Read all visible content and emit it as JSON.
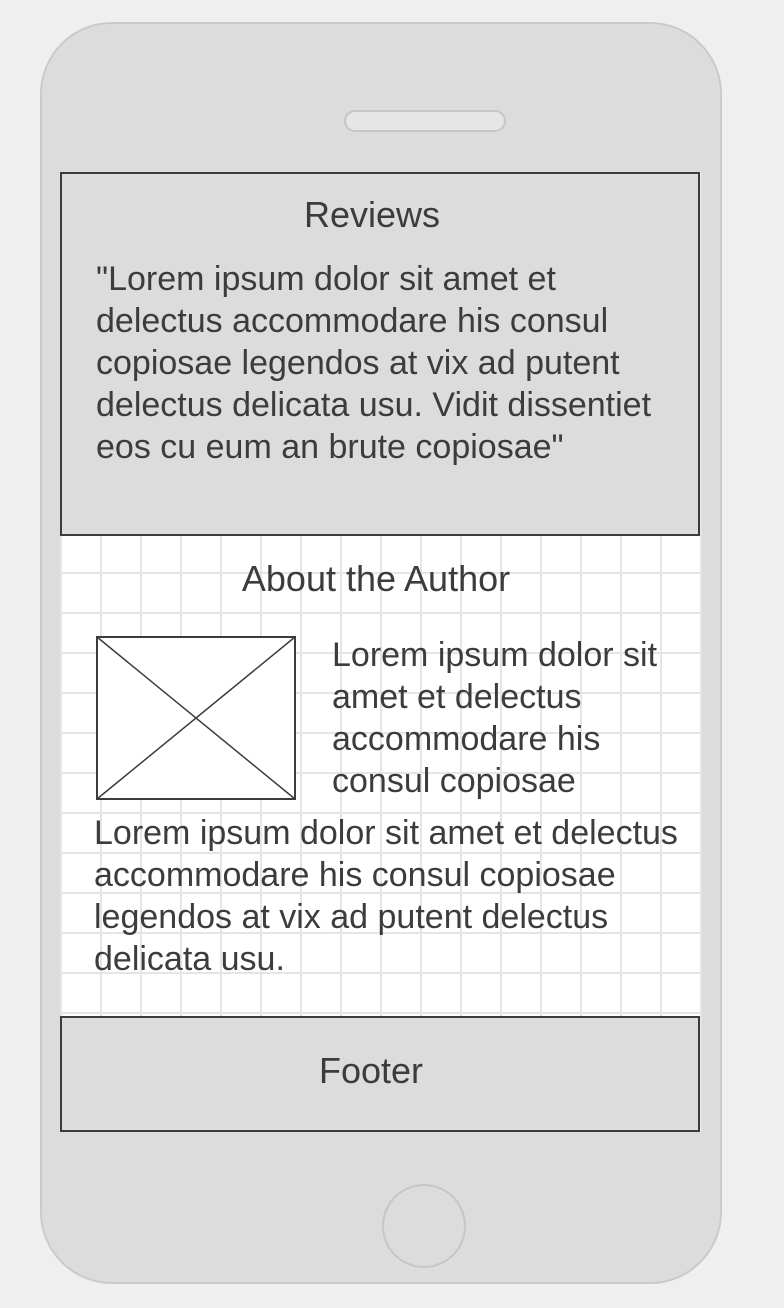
{
  "reviews": {
    "title": "Reviews",
    "quote": "\"Lorem ipsum dolor sit amet et delectus accommodare his consul copiosae legendos at vix ad putent delectus delicata usu. Vidit dissentiet eos cu eum an brute copiosae\""
  },
  "about": {
    "title": "About the Author",
    "photo_icon": "image-placeholder-icon",
    "short_text": "Lorem ipsum dolor sit amet et delectus accommodare his consul copiosae",
    "bio": "Lorem ipsum dolor sit amet et delectus accommodare his consul copiosae legendos at vix ad putent delectus delicata usu."
  },
  "footer": {
    "label": "Footer"
  },
  "colors": {
    "device_body": "#dcdcdc",
    "border": "#3c3c3c",
    "text": "#3c3c3c",
    "background": "#efefef"
  }
}
